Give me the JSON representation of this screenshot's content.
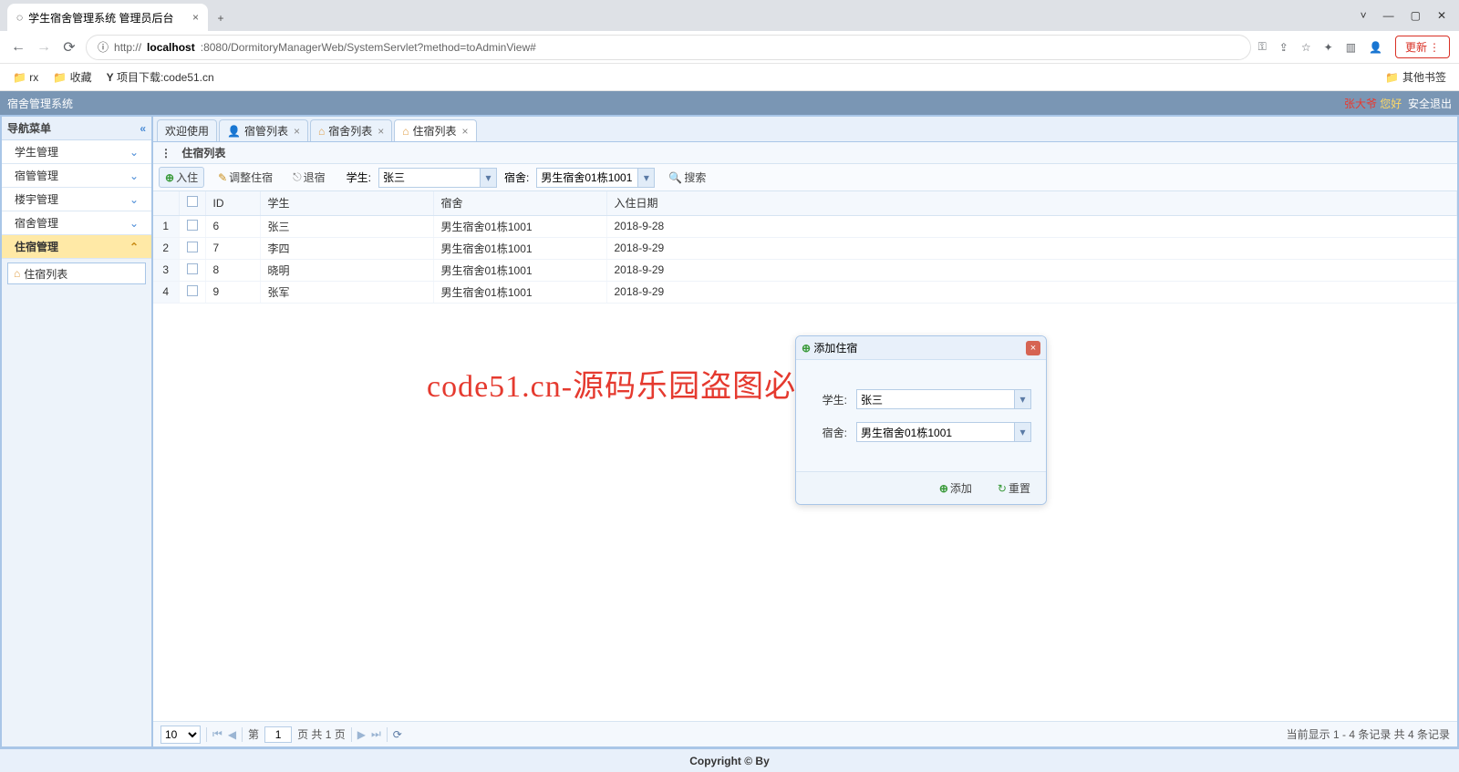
{
  "browser": {
    "tab_title": "学生宿舍管理系统 管理员后台",
    "url_prefix": "http://",
    "url_host": "localhost",
    "url_path": ":8080/DormitoryManagerWeb/SystemServlet?method=toAdminView#",
    "update_label": "更新",
    "bookmarks": [
      "rx",
      "收藏",
      "项目下载:code51.cn"
    ],
    "other_bookmarks_label": "其他书签"
  },
  "header": {
    "title": "宿舍管理系统",
    "user": "张大爷",
    "greeting": "您好",
    "logout": "安全退出"
  },
  "sidebar": {
    "title": "导航菜单",
    "items": [
      "学生管理",
      "宿管管理",
      "楼宇管理",
      "宿舍管理",
      "住宿管理"
    ],
    "sub": "住宿列表"
  },
  "tabs": [
    "欢迎使用",
    "宿管列表",
    "宿舍列表",
    "住宿列表"
  ],
  "panel_title": "住宿列表",
  "toolbar": {
    "checkin": "入住",
    "adjust": "调整住宿",
    "checkout": "退宿",
    "student_label": "学生:",
    "student_value": "张三",
    "dorm_label": "宿舍:",
    "dorm_value": "男生宿舍01栋1001",
    "search": "搜索"
  },
  "table": {
    "cols": [
      "",
      "",
      "ID",
      "学生",
      "宿舍",
      "入住日期"
    ],
    "rows": [
      {
        "n": "1",
        "id": "6",
        "stu": "张三",
        "dorm": "男生宿舍01栋1001",
        "date": "2018-9-28"
      },
      {
        "n": "2",
        "id": "7",
        "stu": "李四",
        "dorm": "男生宿舍01栋1001",
        "date": "2018-9-29"
      },
      {
        "n": "3",
        "id": "8",
        "stu": "晓明",
        "dorm": "男生宿舍01栋1001",
        "date": "2018-9-29"
      },
      {
        "n": "4",
        "id": "9",
        "stu": "张军",
        "dorm": "男生宿舍01栋1001",
        "date": "2018-9-29"
      }
    ]
  },
  "pager": {
    "size": "10",
    "page_prefix": "第",
    "page": "1",
    "page_suffix": "页 共 1 页",
    "info": "当前显示 1 - 4 条记录 共 4 条记录"
  },
  "dialog": {
    "title": "添加住宿",
    "student_label": "学生:",
    "student_value": "张三",
    "dorm_label": "宿舍:",
    "dorm_value": "男生宿舍01栋1001",
    "add": "添加",
    "reset": "重置"
  },
  "footer": "Copyright © By",
  "watermark": "code51.cn-源码乐园盗图必究"
}
